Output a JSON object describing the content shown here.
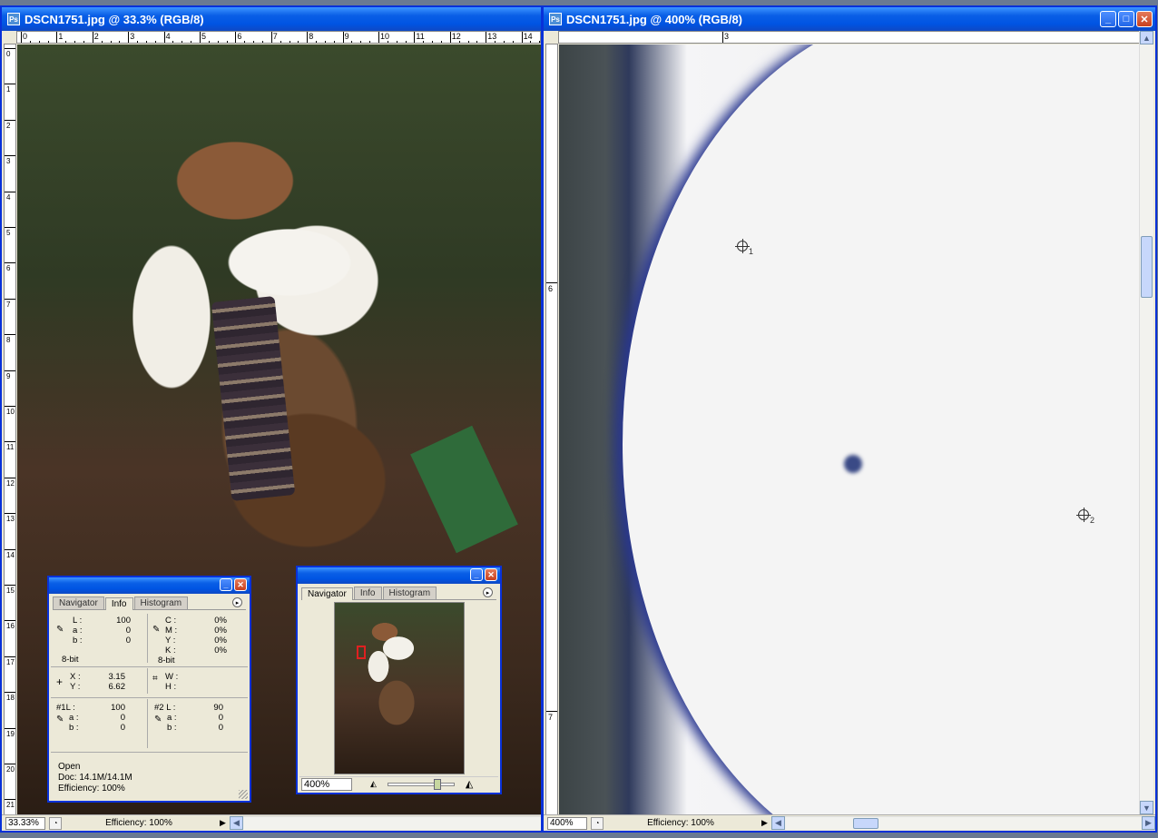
{
  "left_window": {
    "title": "DSCN1751.jpg @ 33.3% (RGB/8)",
    "ruler_h": [
      "0",
      "1",
      "2",
      "3",
      "4",
      "5",
      "6",
      "7",
      "8",
      "9",
      "10",
      "11",
      "12",
      "13",
      "14"
    ],
    "ruler_v": [
      "0",
      "1",
      "2",
      "3",
      "4",
      "5",
      "6",
      "7",
      "8",
      "9",
      "10",
      "11",
      "12",
      "13",
      "14",
      "15",
      "16",
      "17",
      "18",
      "19",
      "20",
      "21"
    ],
    "zoom": "33.33%",
    "status": "Efficiency: 100%"
  },
  "right_window": {
    "title": "DSCN1751.jpg @ 400% (RGB/8)",
    "ruler_h": [
      "3"
    ],
    "ruler_v": [
      "6",
      "7"
    ],
    "zoom": "400%",
    "status": "Efficiency: 100%",
    "sampler1": "1",
    "sampler2": "2"
  },
  "info_panel": {
    "tabs": [
      "Navigator",
      "Info",
      "Histogram"
    ],
    "lab": {
      "L": "L :",
      "L_val": "100",
      "a": "a :",
      "a_val": "0",
      "b": "b :",
      "b_val": "0",
      "bit": "8-bit"
    },
    "cmyk": {
      "C": "C :",
      "C_val": "0%",
      "M": "M :",
      "M_val": "0%",
      "Y": "Y :",
      "Y_val": "0%",
      "K": "K :",
      "K_val": "0%",
      "bit": "8-bit"
    },
    "xy": {
      "X": "X :",
      "X_val": "3.15",
      "Y": "Y :",
      "Y_val": "6.62"
    },
    "wh": {
      "W": "W :",
      "H": "H :"
    },
    "s1": {
      "L": "#1L :",
      "L_val": "100",
      "a": "a :",
      "a_val": "0",
      "b": "b :",
      "b_val": "0"
    },
    "s2": {
      "L": "#2 L :",
      "L_val": "90",
      "a": "a :",
      "a_val": "0",
      "b": "b :",
      "b_val": "0"
    },
    "footer": [
      "Open",
      "Doc: 14.1M/14.1M",
      "Efficiency: 100%"
    ]
  },
  "nav_panel": {
    "tabs": [
      "Navigator",
      "Info",
      "Histogram"
    ],
    "zoom": "400%"
  },
  "colors": {
    "titlebar": "#0054e3",
    "chrome": "#ece9d8",
    "red_box": "#e02020"
  }
}
